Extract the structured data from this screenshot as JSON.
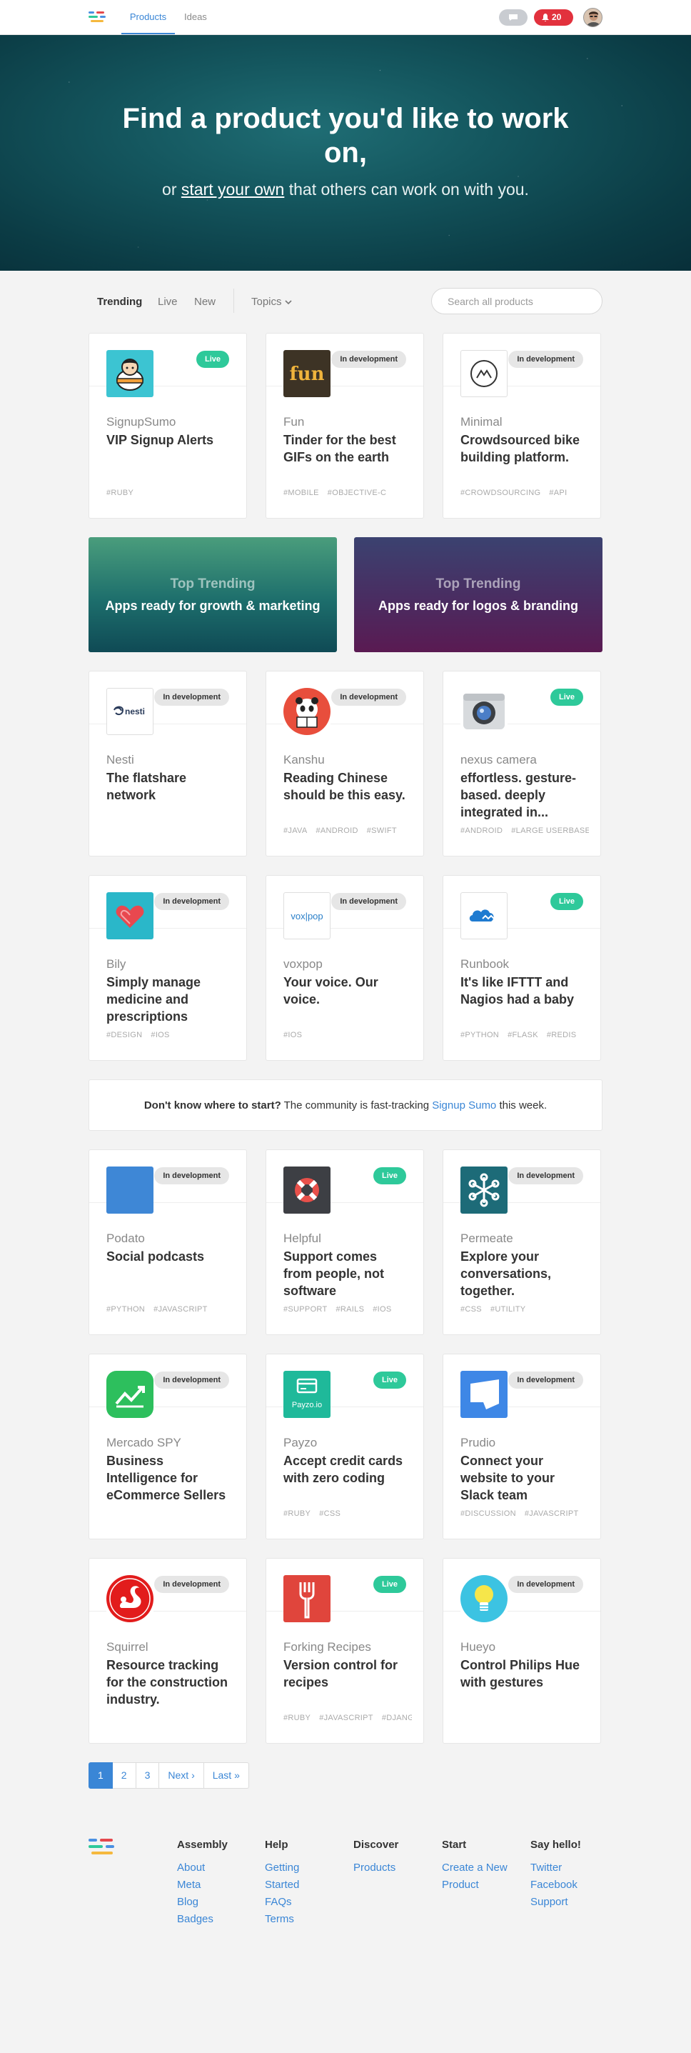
{
  "header": {
    "tabs": [
      {
        "label": "Products"
      },
      {
        "label": "Ideas"
      }
    ],
    "notifications_count": "20"
  },
  "hero": {
    "title": "Find a product you'd like to work on,",
    "subtitle_prefix": "or ",
    "subtitle_link": "start your own",
    "subtitle_suffix": " that others can work on with you."
  },
  "filters": {
    "tabs": [
      {
        "label": "Trending"
      },
      {
        "label": "Live"
      },
      {
        "label": "New"
      }
    ],
    "topics_label": "Topics",
    "search_placeholder": "Search all products"
  },
  "cards_row1": [
    {
      "name": "SignupSumo",
      "tagline": "VIP Signup Alerts",
      "status": "Live",
      "tags": [
        "#RUBY"
      ]
    },
    {
      "name": "Fun",
      "tagline": "Tinder for the best GIFs on the earth",
      "status": "In development",
      "tags": [
        "#MOBILE",
        "#OBJECTIVE-C"
      ]
    },
    {
      "name": "Minimal",
      "tagline": "Crowdsourced bike building platform.",
      "status": "In development",
      "tags": [
        "#CROWDSOURCING",
        "#API"
      ]
    }
  ],
  "banners": [
    {
      "title": "Top Trending",
      "subtitle": "Apps ready for growth & marketing"
    },
    {
      "title": "Top Trending",
      "subtitle": "Apps ready for logos & branding"
    }
  ],
  "cards_row2": [
    {
      "name": "Nesti",
      "tagline": "The flatshare network",
      "status": "In development",
      "tags": []
    },
    {
      "name": "Kanshu",
      "tagline": "Reading Chinese should be this easy.",
      "status": "In development",
      "tags": [
        "#JAVA",
        "#ANDROID",
        "#SWIFT"
      ]
    },
    {
      "name": "nexus camera",
      "tagline": "effortless. gesture-based. deeply integrated in...",
      "status": "Live",
      "tags": [
        "#ANDROID",
        "#LARGE USERBASE"
      ]
    }
  ],
  "cards_row3": [
    {
      "name": "Bily",
      "tagline": "Simply manage medicine and prescriptions",
      "status": "In development",
      "tags": [
        "#DESIGN",
        "#IOS"
      ]
    },
    {
      "name": "voxpop",
      "tagline": "Your voice. Our voice.",
      "status": "In development",
      "tags": [
        "#IOS"
      ]
    },
    {
      "name": "Runbook",
      "tagline": "It's like IFTTT and Nagios had a baby",
      "status": "Live",
      "tags": [
        "#PYTHON",
        "#FLASK",
        "#REDIS"
      ]
    }
  ],
  "promo": {
    "bold": "Don't know where to start?",
    "text": " The community is fast-tracking ",
    "link": "Signup Sumo",
    "suffix": " this week."
  },
  "cards_row4": [
    {
      "name": "Podato",
      "tagline": "Social podcasts",
      "status": "In development",
      "tags": [
        "#PYTHON",
        "#JAVASCRIPT"
      ]
    },
    {
      "name": "Helpful",
      "tagline": "Support comes from people, not software",
      "status": "Live",
      "tags": [
        "#SUPPORT",
        "#RAILS",
        "#IOS"
      ]
    },
    {
      "name": "Permeate",
      "tagline": "Explore your conversations, together.",
      "status": "In development",
      "tags": [
        "#CSS",
        "#UTILITY"
      ]
    }
  ],
  "cards_row5": [
    {
      "name": "Mercado SPY",
      "tagline": "Business Intelligence for eCommerce Sellers",
      "status": "In development",
      "tags": []
    },
    {
      "name": "Payzo",
      "tagline": "Accept credit cards with zero coding",
      "status": "Live",
      "tags": [
        "#RUBY",
        "#CSS"
      ],
      "logo_text": "Payzo.io"
    },
    {
      "name": "Prudio",
      "tagline": "Connect your website to your Slack team",
      "status": "In development",
      "tags": [
        "#DISCUSSION",
        "#JAVASCRIPT"
      ]
    }
  ],
  "cards_row6": [
    {
      "name": "Squirrel",
      "tagline": "Resource tracking for the construction industry.",
      "status": "In development",
      "tags": []
    },
    {
      "name": "Forking Recipes",
      "tagline": "Version control for recipes",
      "status": "Live",
      "tags": [
        "#RUBY",
        "#JAVASCRIPT",
        "#DJANGO"
      ]
    },
    {
      "name": "Hueyo",
      "tagline": "Control Philips Hue with gestures",
      "status": "In development",
      "tags": []
    }
  ],
  "pagination": {
    "pages": [
      "1",
      "2",
      "3"
    ],
    "next": "Next ›",
    "last": "Last »"
  },
  "footer": {
    "columns": [
      {
        "title": "Assembly",
        "links": [
          "About",
          "Meta",
          "Blog",
          "Badges"
        ]
      },
      {
        "title": "Help",
        "links": [
          "Getting Started",
          "FAQs",
          "Terms"
        ]
      },
      {
        "title": "Discover",
        "links": [
          "Products"
        ]
      },
      {
        "title": "Start",
        "links": [
          "Create a New Product"
        ]
      },
      {
        "title": "Say hello!",
        "links": [
          "Twitter",
          "Facebook",
          "Support"
        ]
      }
    ]
  },
  "logo_texts": {
    "nesti": "nesti",
    "fun": "fun",
    "voxpop": "vox|pop"
  },
  "colors": {
    "accent": "#3a86d6",
    "live": "#2ec99a",
    "notification": "#e2313d"
  }
}
